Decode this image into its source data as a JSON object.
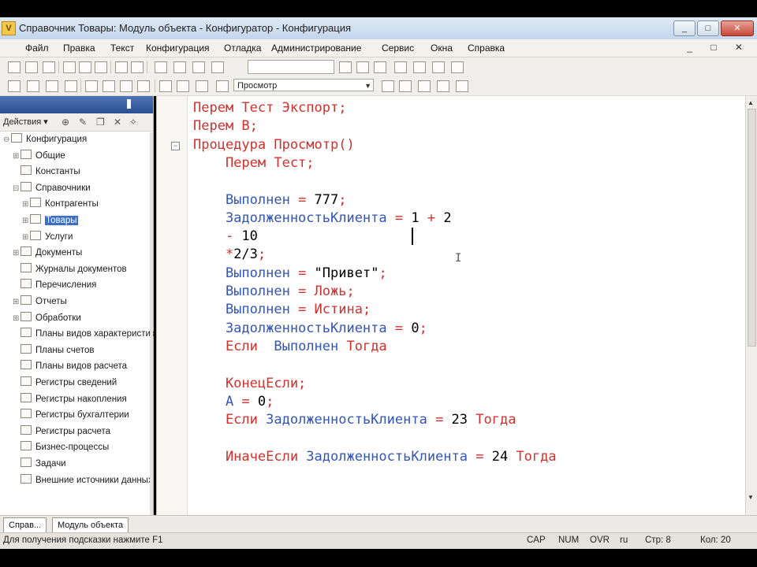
{
  "window": {
    "title": "Справочник Товары: Модуль объекта - Конфигуратор - Конфигурация",
    "app_icon_letter": "V",
    "controls": [
      "_",
      "□",
      "✕"
    ]
  },
  "menubar": {
    "items": [
      "Файл",
      "Правка",
      "Текст",
      "Конфигурация",
      "Отладка",
      "Администрирование",
      "Сервис",
      "Окна",
      "Справка"
    ],
    "mdi_controls": "_ □ ✕"
  },
  "toolbar2": {
    "select_value": "Просмотр"
  },
  "left_panel": {
    "actions_label": "Действия ▾",
    "action_icons": [
      "add-icon",
      "edit-icon",
      "copy-icon",
      "delete-icon",
      "properties-icon"
    ],
    "tree": [
      {
        "label": "Конфигурация",
        "level": 0,
        "expander": "⊖"
      },
      {
        "label": "Общие",
        "level": 1,
        "expander": "⊞"
      },
      {
        "label": "Константы",
        "level": 1,
        "expander": ""
      },
      {
        "label": "Справочники",
        "level": 1,
        "expander": "⊟"
      },
      {
        "label": "Контрагенты",
        "level": 2,
        "expander": "⊞"
      },
      {
        "label": "Товары",
        "level": 2,
        "expander": "⊞",
        "selected": true
      },
      {
        "label": "Услуги",
        "level": 2,
        "expander": "⊞"
      },
      {
        "label": "Документы",
        "level": 1,
        "expander": "⊞"
      },
      {
        "label": "Журналы документов",
        "level": 1,
        "expander": ""
      },
      {
        "label": "Перечисления",
        "level": 1,
        "expander": ""
      },
      {
        "label": "Отчеты",
        "level": 1,
        "expander": "⊞"
      },
      {
        "label": "Обработки",
        "level": 1,
        "expander": "⊞"
      },
      {
        "label": "Планы видов характеристик",
        "level": 1,
        "expander": ""
      },
      {
        "label": "Планы счетов",
        "level": 1,
        "expander": ""
      },
      {
        "label": "Планы видов расчета",
        "level": 1,
        "expander": ""
      },
      {
        "label": "Регистры сведений",
        "level": 1,
        "expander": ""
      },
      {
        "label": "Регистры накопления",
        "level": 1,
        "expander": ""
      },
      {
        "label": "Регистры бухгалтерии",
        "level": 1,
        "expander": ""
      },
      {
        "label": "Регистры расчета",
        "level": 1,
        "expander": ""
      },
      {
        "label": "Бизнес-процессы",
        "level": 1,
        "expander": ""
      },
      {
        "label": "Задачи",
        "level": 1,
        "expander": ""
      },
      {
        "label": "Внешние источники данных",
        "level": 1,
        "expander": ""
      }
    ]
  },
  "editor": {
    "lines": [
      [
        {
          "t": "Перем Тест Экспорт;",
          "c": "kw"
        }
      ],
      [
        {
          "t": "Перем В;",
          "c": "kw"
        }
      ],
      [
        {
          "t": "Процедура Просмотр()",
          "c": "kw"
        }
      ],
      [
        {
          "t": "    Перем Тест;",
          "c": "kw"
        }
      ],
      [],
      [
        {
          "t": "    Выполнен ",
          "c": "id"
        },
        {
          "t": "= ",
          "c": "op"
        },
        {
          "t": "777",
          "c": "num"
        },
        {
          "t": ";",
          "c": "op"
        }
      ],
      [
        {
          "t": "    ЗадолженностьКлиента ",
          "c": "id"
        },
        {
          "t": "= ",
          "c": "op"
        },
        {
          "t": "1 ",
          "c": "num"
        },
        {
          "t": "+ ",
          "c": "op"
        },
        {
          "t": "2",
          "c": "num"
        }
      ],
      [
        {
          "t": "    - ",
          "c": "op"
        },
        {
          "t": "10",
          "c": "num"
        }
      ],
      [
        {
          "t": "    *",
          "c": "op"
        },
        {
          "t": "2/3",
          "c": "num"
        },
        {
          "t": ";",
          "c": "op"
        }
      ],
      [
        {
          "t": "    Выполнен ",
          "c": "id"
        },
        {
          "t": "= ",
          "c": "op"
        },
        {
          "t": "\"Привет\"",
          "c": "str"
        },
        {
          "t": ";",
          "c": "op"
        }
      ],
      [
        {
          "t": "    Выполнен ",
          "c": "id"
        },
        {
          "t": "= Ложь;",
          "c": "op"
        }
      ],
      [
        {
          "t": "    Выполнен ",
          "c": "id"
        },
        {
          "t": "= Истина;",
          "c": "op"
        }
      ],
      [
        {
          "t": "    ЗадолженностьКлиента ",
          "c": "id"
        },
        {
          "t": "= ",
          "c": "op"
        },
        {
          "t": "0",
          "c": "num"
        },
        {
          "t": ";",
          "c": "op"
        }
      ],
      [
        {
          "t": "    Если ",
          "c": "kw"
        },
        {
          "t": " Выполнен ",
          "c": "id"
        },
        {
          "t": "Тогда",
          "c": "kw"
        }
      ],
      [],
      [
        {
          "t": "    КонецЕсли;",
          "c": "kw"
        }
      ],
      [
        {
          "t": "    А ",
          "c": "id"
        },
        {
          "t": "= ",
          "c": "op"
        },
        {
          "t": "0",
          "c": "num"
        },
        {
          "t": ";",
          "c": "op"
        }
      ],
      [
        {
          "t": "    Если ",
          "c": "kw"
        },
        {
          "t": "ЗадолженностьКлиента ",
          "c": "id"
        },
        {
          "t": "= ",
          "c": "op"
        },
        {
          "t": "23 ",
          "c": "num"
        },
        {
          "t": "Тогда",
          "c": "kw"
        }
      ],
      [],
      [
        {
          "t": "    ИначеЕсли ",
          "c": "kw"
        },
        {
          "t": "ЗадолженностьКлиента ",
          "c": "id"
        },
        {
          "t": "= ",
          "c": "op"
        },
        {
          "t": "24 ",
          "c": "num"
        },
        {
          "t": "Тогда",
          "c": "kw"
        }
      ]
    ]
  },
  "bottom_tabs": [
    "Справ...",
    "Модуль объекта"
  ],
  "statusbar": {
    "hint": "Для получения подсказки нажмите F1",
    "cap": "CAP",
    "num": "NUM",
    "ovr": "OVR",
    "lang": "ru",
    "line": "Стр: 8",
    "col": "Кол: 20"
  },
  "colors": {
    "keyword": "#d0312d",
    "identifier": "#3355b5",
    "selection": "#3b6fc4"
  }
}
